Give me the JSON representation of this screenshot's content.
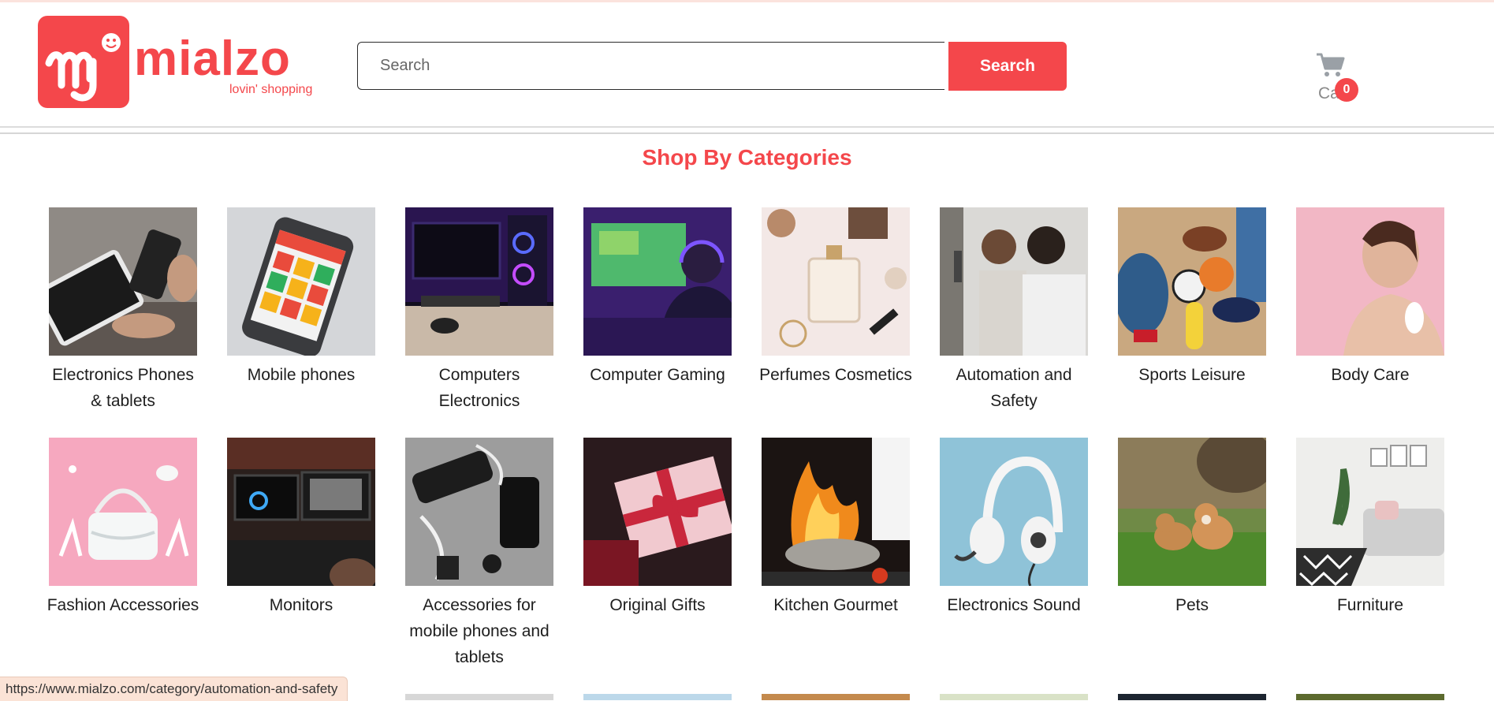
{
  "header": {
    "logo": {
      "wordmark": "mialzo",
      "tagline": "lovin' shopping"
    },
    "search": {
      "placeholder": "Search",
      "value": "",
      "button_label": "Search"
    },
    "cart": {
      "label": "Cart",
      "count": "0"
    }
  },
  "section": {
    "title": "Shop By Categories"
  },
  "categories": [
    {
      "label": "Electronics Phones & tablets",
      "icon": "phone-tablet-photo"
    },
    {
      "label": "Mobile phones",
      "icon": "smartphone-photo"
    },
    {
      "label": "Computers Electronics",
      "icon": "gaming-pc-photo"
    },
    {
      "label": "Computer Gaming",
      "icon": "gamer-photo"
    },
    {
      "label": "Perfumes Cosmetics",
      "icon": "perfume-photo"
    },
    {
      "label": "Automation and Safety",
      "icon": "smart-home-photo"
    },
    {
      "label": "Sports Leisure",
      "icon": "sports-gear-photo"
    },
    {
      "label": "Body Care",
      "icon": "skincare-photo"
    },
    {
      "label": "Fashion Accessories",
      "icon": "handbag-photo"
    },
    {
      "label": "Monitors",
      "icon": "monitor-photo"
    },
    {
      "label": "Accessories for mobile phones and tablets",
      "icon": "chargers-photo"
    },
    {
      "label": "Original Gifts",
      "icon": "gift-photo"
    },
    {
      "label": "Kitchen Gourmet",
      "icon": "wok-fire-photo"
    },
    {
      "label": "Electronics Sound",
      "icon": "headset-photo"
    },
    {
      "label": "Pets",
      "icon": "dogs-photo"
    },
    {
      "label": "Furniture",
      "icon": "living-room-photo"
    }
  ],
  "status_bar": {
    "url": "https://www.mialzo.com/category/automation-and-safety"
  },
  "colors": {
    "brand": "#f4474b",
    "text": "#1e1e1e",
    "status_bg": "#fbe3d6"
  }
}
